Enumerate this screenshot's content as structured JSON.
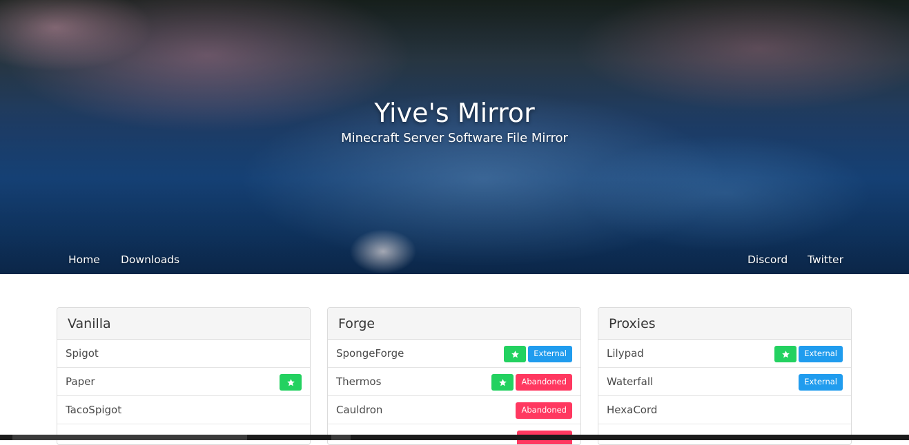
{
  "hero": {
    "title": "Yive's Mirror",
    "subtitle": "Minecraft Server Software File Mirror"
  },
  "nav": {
    "left": [
      "Home",
      "Downloads"
    ],
    "right": [
      "Discord",
      "Twitter"
    ]
  },
  "colors": {
    "star": "#23d160",
    "external": "#209cee",
    "abandoned": "#ff3860"
  },
  "panels": [
    {
      "title": "Vanilla",
      "items": [
        {
          "name": "Spigot",
          "star": false,
          "tags": []
        },
        {
          "name": "Paper",
          "star": true,
          "tags": []
        },
        {
          "name": "TacoSpigot",
          "star": false,
          "tags": []
        }
      ]
    },
    {
      "title": "Forge",
      "items": [
        {
          "name": "SpongeForge",
          "star": true,
          "tags": [
            "External"
          ]
        },
        {
          "name": "Thermos",
          "star": true,
          "tags": [
            "Abandoned"
          ]
        },
        {
          "name": "Cauldron",
          "star": false,
          "tags": [
            "Abandoned"
          ]
        }
      ]
    },
    {
      "title": "Proxies",
      "items": [
        {
          "name": "Lilypad",
          "star": true,
          "tags": [
            "External"
          ]
        },
        {
          "name": "Waterfall",
          "star": false,
          "tags": [
            "External"
          ]
        },
        {
          "name": "HexaCord",
          "star": false,
          "tags": []
        }
      ]
    }
  ],
  "icons": {
    "star": "star-icon"
  }
}
